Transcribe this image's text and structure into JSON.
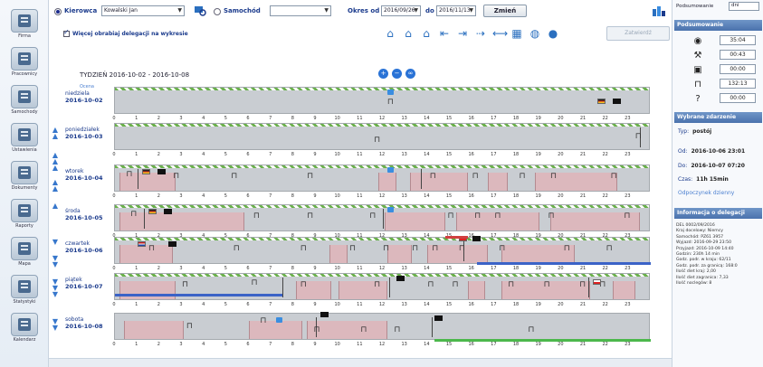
{
  "nav": [
    {
      "label": "Firma",
      "icon": "building-icon"
    },
    {
      "label": "Pracownicy",
      "icon": "person-icon"
    },
    {
      "label": "Samochody",
      "icon": "truck-icon"
    },
    {
      "label": "Ustawienia",
      "icon": "gear-icon"
    },
    {
      "label": "Dokumenty",
      "icon": "document-icon"
    },
    {
      "label": "Raporty",
      "icon": "report-icon"
    },
    {
      "label": "Mapa",
      "icon": "map-icon"
    },
    {
      "label": "Statystyki",
      "icon": "chart-icon"
    },
    {
      "label": "Kalendarz",
      "icon": "calendar-icon"
    }
  ],
  "toolbar": {
    "driver_label": "Kierowca",
    "driver_value": "Kowalski Jan",
    "vehicle_label": "Samochód",
    "vehicle_value": "",
    "period_label": "Okres od",
    "date_from": "2016/09/26",
    "date_to_label": "do",
    "date_to": "2016/11/13",
    "apply_label": "Zmień"
  },
  "options": {
    "checkbox_label": "Więcej obrabiaj delegacji na wykresie",
    "disabled_button": "Zatwierdź"
  },
  "week": {
    "title": "TYDZIEŃ 2016-10-02 - 2016-10-08",
    "legend": "Ocena"
  },
  "days": [
    {
      "name": "niedziela",
      "date": "2016-10-02"
    },
    {
      "name": "poniedziałek",
      "date": "2016-10-03"
    },
    {
      "name": "wtorek",
      "date": "2016-10-04"
    },
    {
      "name": "środa",
      "date": "2016-10-05"
    },
    {
      "name": "czwartek",
      "date": "2016-10-06"
    },
    {
      "name": "piątek",
      "date": "2016-10-07"
    },
    {
      "name": "sobota",
      "date": "2016-10-08"
    }
  ],
  "hours": [
    "0",
    "1",
    "2",
    "3",
    "4",
    "5",
    "6",
    "7",
    "8",
    "9",
    "10",
    "11",
    "12",
    "13",
    "14",
    "15",
    "16",
    "17",
    "18",
    "19",
    "20",
    "21",
    "22",
    "23"
  ],
  "right_panel": {
    "sort_label": "Podsumowanie",
    "sort_value": "dni",
    "summary_header": "Podsumowanie",
    "summary": [
      {
        "icon": "steering-wheel-icon",
        "value": "35:04"
      },
      {
        "icon": "hammer-icon",
        "value": "00:43"
      },
      {
        "icon": "availability-icon",
        "value": "00:00"
      },
      {
        "icon": "bed-icon",
        "value": "132:13"
      },
      {
        "icon": "question-icon",
        "value": "00:00"
      }
    ],
    "event_header": "Wybrane zdarzenie",
    "event_type_label": "Typ:",
    "event_type": "postój",
    "event_from_label": "Od:",
    "event_from": "2016-10-06 23:01",
    "event_to_label": "Do:",
    "event_to": "2016-10-07 07:20",
    "event_duration_label": "Czas:",
    "event_duration": "11h 15min",
    "event_link": "Odpoczynek dzienny",
    "deleg_header": "Informacja o delegacji",
    "deleg_lines": [
      "DEL 0002/09/2016",
      "Kraj docelowy: Niemcy",
      "Samochód: PZ61 3957",
      "Wyjazd: 2016-09-29 23:50",
      "Przyjazd: 2016-10-09 14:40",
      "Godzin: 230h 14 min",
      "Godz. podr. w kraju: 62/11",
      "Godz. podr. za granicą: 168:0",
      "Ilość diet kraj: 2,00",
      "Ilość diet zagranica: 7,33",
      "Ilość noclegów: 8"
    ]
  },
  "bottom": {
    "left": "",
    "right": ""
  }
}
